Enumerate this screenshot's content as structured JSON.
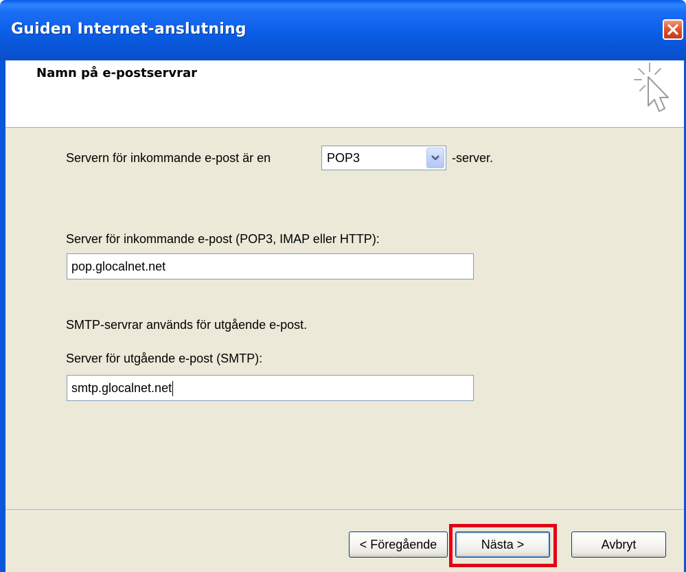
{
  "window": {
    "title": "Guiden Internet-anslutning"
  },
  "header": {
    "title": "Namn på e-postservrar"
  },
  "icons": {
    "close": "close-icon",
    "wizard": "wizard-cursor-icon",
    "dropdown": "chevron-down-icon"
  },
  "form": {
    "server_type_label": "Servern för inkommande e-post är en",
    "server_type_value": "POP3",
    "server_type_suffix": "-server.",
    "incoming_label": "Server för inkommande e-post (POP3, IMAP eller HTTP):",
    "incoming_value": "pop.glocalnet.net",
    "smtp_info": "SMTP-servrar används för utgående e-post.",
    "outgoing_label": "Server för utgående e-post (SMTP):",
    "outgoing_value": "smtp.glocalnet.net"
  },
  "buttons": {
    "back": "< Föregående",
    "next": "Nästa >",
    "cancel": "Avbryt"
  },
  "colors": {
    "titlebar": "#0b5ee6",
    "highlight": "#e0001a",
    "dialog_bg": "#ece9d8"
  }
}
